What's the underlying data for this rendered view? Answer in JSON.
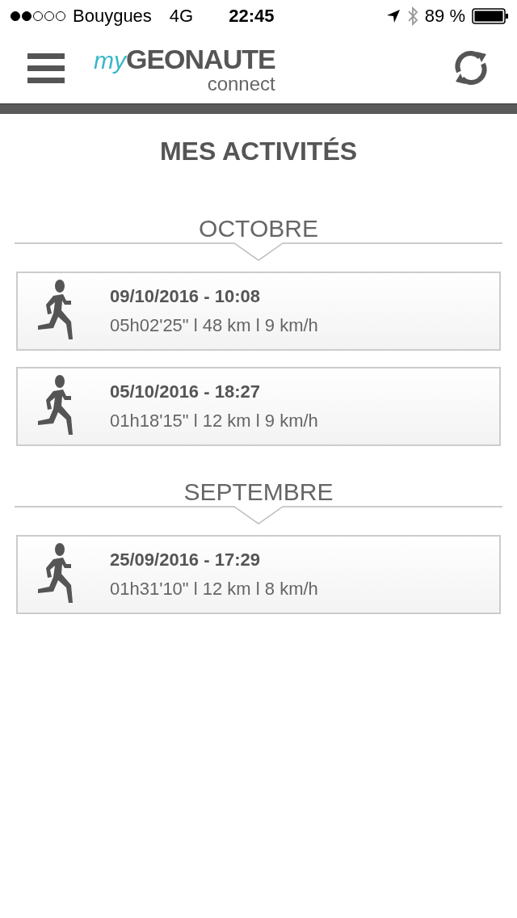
{
  "status_bar": {
    "carrier": "Bouygues",
    "network": "4G",
    "time": "22:45",
    "battery": "89 %"
  },
  "header": {
    "logo": {
      "prefix": "my",
      "name": "GEONAUTE",
      "suffix": "connect"
    }
  },
  "title": "MES ACTIVITÉS",
  "months": [
    {
      "name": "OCTOBRE",
      "activities": [
        {
          "date": "09/10/2016 - 10:08",
          "stats": "05h02'25\" l 48 km l 9 km/h"
        },
        {
          "date": "05/10/2016 - 18:27",
          "stats": "01h18'15\" l 12 km l 9 km/h"
        }
      ]
    },
    {
      "name": "SEPTEMBRE",
      "activities": [
        {
          "date": "25/09/2016 - 17:29",
          "stats": "01h31'10\" l 12 km l 8 km/h"
        }
      ]
    }
  ]
}
